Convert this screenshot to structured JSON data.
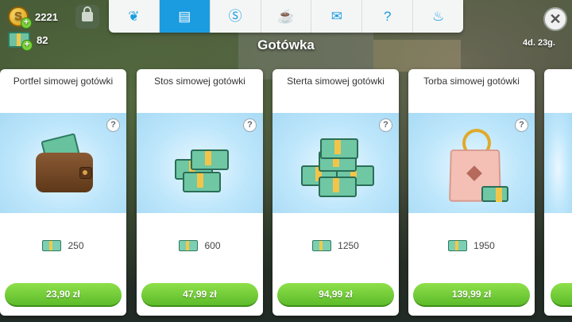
{
  "currency": {
    "coins_value": "2221",
    "cash_value": "82"
  },
  "tabs": [
    {
      "name": "tab-bookmark",
      "icon": "ribbon-icon",
      "glyph": "❦",
      "active": false
    },
    {
      "name": "tab-cash",
      "icon": "cash-icon",
      "glyph": "▤",
      "active": true
    },
    {
      "name": "tab-simoleons",
      "icon": "simoleon-icon",
      "glyph": "Ⓢ",
      "active": false
    },
    {
      "name": "tab-food",
      "icon": "cupcake-icon",
      "glyph": "☕",
      "active": false
    },
    {
      "name": "tab-tickets",
      "icon": "ticket-icon",
      "glyph": "✉",
      "active": false
    },
    {
      "name": "tab-box",
      "icon": "box-icon",
      "glyph": "?",
      "active": false
    },
    {
      "name": "tab-special",
      "icon": "flame-icon",
      "glyph": "♨",
      "active": false
    }
  ],
  "section_title": "Gotówka",
  "timer": "4d. 23g.",
  "cards": [
    {
      "title": "Portfel simowej gotówki",
      "amount": "250",
      "price": "23,90 zł",
      "art": "wallet"
    },
    {
      "title": "Stos simowej gotówki",
      "amount": "600",
      "price": "47,99 zł",
      "art": "stack"
    },
    {
      "title": "Sterta simowej gotówki",
      "amount": "1250",
      "price": "94,99 zł",
      "art": "pile"
    },
    {
      "title": "Torba simowej gotówki",
      "amount": "1950",
      "price": "139,99 zł",
      "art": "bag"
    }
  ],
  "colors": {
    "active_tab": "#1b9ce0",
    "buy_button": "#5dbb2a"
  }
}
